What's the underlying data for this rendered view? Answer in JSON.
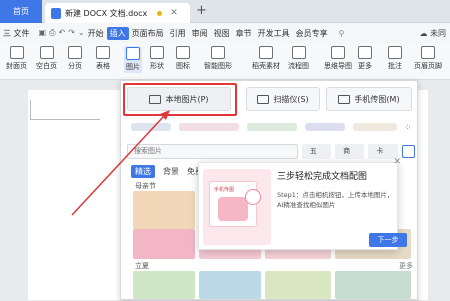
{
  "tabs": {
    "home": "首页",
    "doc_title": "新建 DOCX 文档.docx"
  },
  "menu": {
    "file": "三 文件",
    "items": [
      "开始",
      "插入",
      "页面布局",
      "引用",
      "审阅",
      "视图",
      "章节",
      "开发工具",
      "会员专享"
    ],
    "active": "插入",
    "right": "未同"
  },
  "toolbar": {
    "items": [
      "封面页",
      "空白页",
      "分页",
      "表格",
      "图片",
      "形状",
      "图标",
      "智能图形",
      "稻壳素材",
      "流程图",
      "思维导图",
      "更多",
      "批注",
      "页眉页脚"
    ],
    "active": "图片"
  },
  "dropdown": {
    "local": "本地图片(P)",
    "scan": "扫描仪(S)",
    "phone": "手机传图(M)",
    "search_placeholder": "搜索图片",
    "chips": [
      "五一",
      "商务",
      "卡通"
    ],
    "filters": [
      "精选",
      "背景",
      "免费"
    ],
    "section_a": "母亲节",
    "section_b": "立夏",
    "more": "更多"
  },
  "guide": {
    "title": "三步轻松完成文档配图",
    "step": "Step1：点击相机按钮，上传本地图片，AI精准查找相似图片",
    "card_title": "手机传图",
    "next": "下一步"
  },
  "colors": {
    "accent": "#3f77e6",
    "highlight": "#e2373a"
  }
}
